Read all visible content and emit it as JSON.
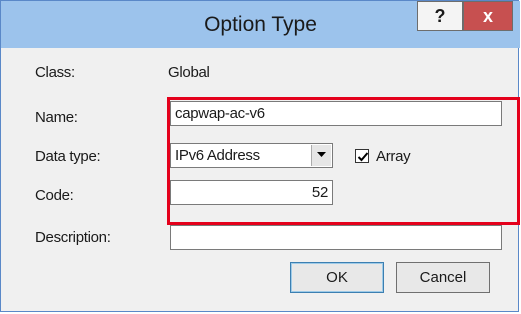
{
  "window": {
    "title": "Option Type",
    "help_glyph": "?",
    "close_glyph": "x"
  },
  "form": {
    "class_label": "Class:",
    "class_value": "Global",
    "name_label": "Name:",
    "name_value": "capwap-ac-v6",
    "datatype_label": "Data type:",
    "datatype_value": "IPv6 Address",
    "array_label": "Array",
    "array_checked": true,
    "code_label": "Code:",
    "code_value": "52",
    "description_label": "Description:",
    "description_value": ""
  },
  "buttons": {
    "ok_label": "OK",
    "cancel_label": "Cancel"
  },
  "colors": {
    "titlebar": "#9cc3ec",
    "close_button": "#c75050",
    "highlight_box": "#e4001b"
  }
}
